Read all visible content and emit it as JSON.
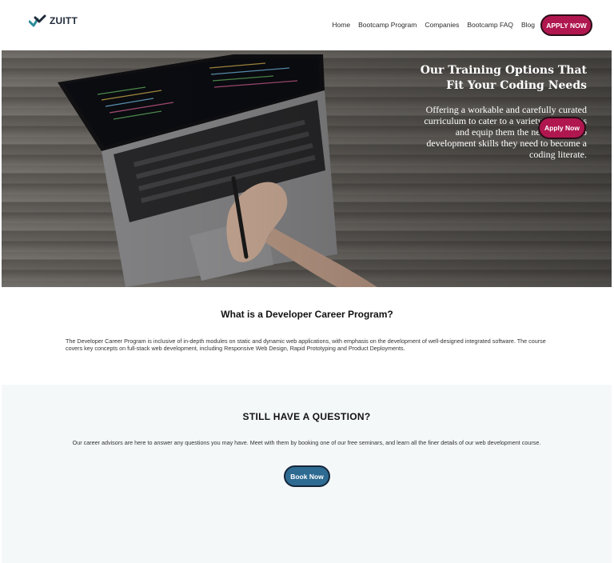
{
  "header": {
    "logo_text": "ZUITT",
    "nav": [
      "Home",
      "Bootcamp Program",
      "Companies",
      "Bootcamp FAQ",
      "Blog"
    ],
    "apply_label": "APPLY NOW"
  },
  "hero": {
    "title": "Our Training Options That Fit Your Coding Needs",
    "subtitle": "Offering a workable and carefully curated curriculum to cater to a variety of students and equip them the necessary web development skills they need to become a coding literate.",
    "button_label": "Apply Now"
  },
  "what": {
    "title": "What is a Developer Career Program?",
    "text": "The Developer Career Program is inclusive of in-depth modules on static and dynamic web applications, with emphasis on the development of well-designed integrated software. The course covers key concepts on full-stack web development, including Responsive Web Design, Rapid Prototyping and Product Deployments."
  },
  "question": {
    "title": "STILL HAVE A QUESTION?",
    "text": "Our career advisors are here to answer any questions you may have. Meet with them by booking one of our free seminars, and learn all the finer details of our web development course.",
    "button_label": "Book Now"
  },
  "colors": {
    "brand": "#b0174f",
    "secondary": "#2e6b92",
    "section_bg": "#f5f8f9"
  }
}
